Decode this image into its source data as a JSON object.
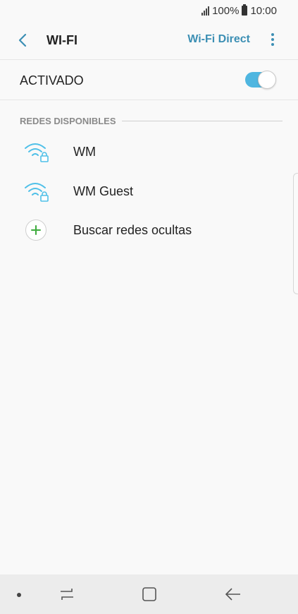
{
  "status_bar": {
    "battery": "100%",
    "time": "10:00"
  },
  "app_bar": {
    "title": "WI-FI",
    "wifi_direct": "Wi-Fi Direct"
  },
  "toggle": {
    "label": "ACTIVADO",
    "on": true
  },
  "section": {
    "title": "REDES DISPONIBLES"
  },
  "networks": [
    {
      "name": "WM",
      "icon": "wifi-lock-icon"
    },
    {
      "name": "WM Guest",
      "icon": "wifi-lock-icon"
    }
  ],
  "add_network": {
    "label": "Buscar redes ocultas",
    "icon": "plus-icon"
  },
  "colors": {
    "accent": "#3c8fb4",
    "toggle_on": "#4fb6e0",
    "wifi": "#4fc0e8",
    "plus": "#3dab3d"
  }
}
